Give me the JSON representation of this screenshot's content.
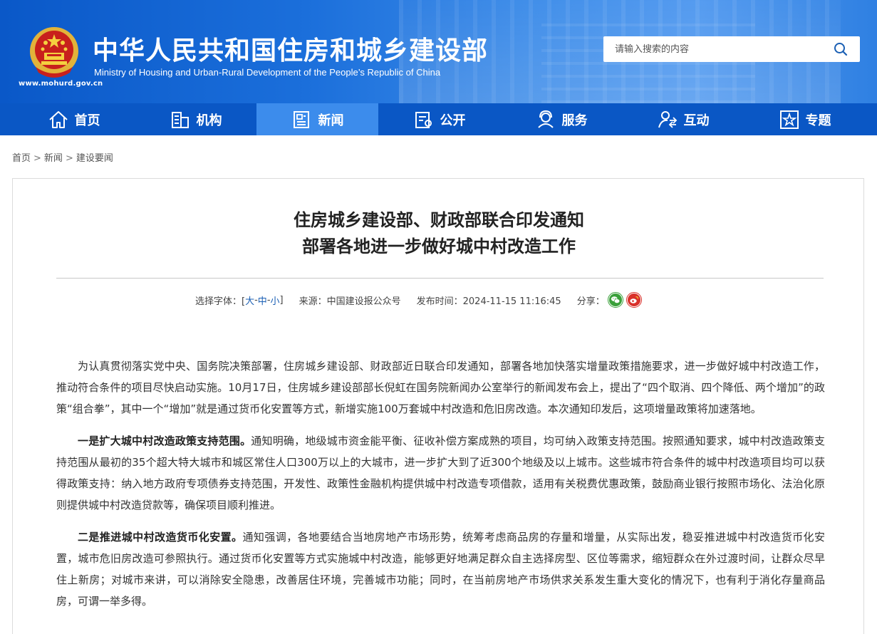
{
  "header": {
    "title": "中华人民共和国住房和城乡建设部",
    "subtitle": "Ministry of Housing and Urban-Rural Development of the People’s Republic of China",
    "url": "www.mohurd.gov.cn",
    "search_placeholder": "请输入搜索的内容",
    "search_icon": "search-icon"
  },
  "nav": {
    "items": [
      {
        "label": "首页",
        "icon": "home-icon"
      },
      {
        "label": "机构",
        "icon": "building-icon"
      },
      {
        "label": "新闻",
        "icon": "news-icon"
      },
      {
        "label": "公开",
        "icon": "document-icon"
      },
      {
        "label": "服务",
        "icon": "service-icon"
      },
      {
        "label": "互动",
        "icon": "interaction-icon"
      },
      {
        "label": "专题",
        "icon": "star-icon"
      }
    ],
    "active": "新闻"
  },
  "breadcrumb": {
    "items": [
      "首页",
      "新闻",
      "建设要闻"
    ],
    "separator": ">"
  },
  "article": {
    "title_line1": "住房城乡建设部、财政部联合印发通知",
    "title_line2": "部署各地进一步做好城中村改造工作",
    "meta": {
      "font_label": "选择字体：[",
      "font_large": "大",
      "font_medium": "中",
      "font_small": "小",
      "font_dash": "-",
      "font_close": "]",
      "source": "来源：中国建设报公众号",
      "publish_time": "发布时间：2024-11-15 11:16:45",
      "share_label": "分享："
    },
    "paragraphs": [
      {
        "lead": "",
        "text": "为认真贯彻落实党中央、国务院决策部署，住房城乡建设部、财政部近日联合印发通知，部署各地加快落实增量政策措施要求，进一步做好城中村改造工作，推动符合条件的项目尽快启动实施。10月17日，住房城乡建设部部长倪虹在国务院新闻办公室举行的新闻发布会上，提出了“四个取消、四个降低、两个增加”的政策“组合拳”，其中一个“增加”就是通过货币化安置等方式，新增实施100万套城中村改造和危旧房改造。本次通知印发后，这项增量政策将加速落地。"
      },
      {
        "lead": "一是扩大城中村改造政策支持范围。",
        "text": "通知明确，地级城市资金能平衡、征收补偿方案成熟的项目，均可纳入政策支持范围。按照通知要求，城中村改造政策支持范围从最初的35个超大特大城市和城区常住人口300万以上的大城市，进一步扩大到了近300个地级及以上城市。这些城市符合条件的城中村改造项目均可以获得政策支持：纳入地方政府专项债券支持范围，开发性、政策性金融机构提供城中村改造专项借款，适用有关税费优惠政策，鼓励商业银行按照市场化、法治化原则提供城中村改造贷款等，确保项目顺利推进。"
      },
      {
        "lead": "二是推进城中村改造货币化安置。",
        "text": "通知强调，各地要结合当地房地产市场形势，统筹考虑商品房的存量和增量，从实际出发，稳妥推进城中村改造货币化安置，城市危旧房改造可参照执行。通过货币化安置等方式实施城中村改造，能够更好地满足群众自主选择房型、区位等需求，缩短群众在外过渡时间，让群众尽早住上新房；对城市来讲，可以消除安全隐患，改善居住环境，完善城市功能；同时，在当前房地产市场供求关系发生重大变化的情况下，也有利于消化存量商品房，可谓一举多得。"
      }
    ]
  }
}
